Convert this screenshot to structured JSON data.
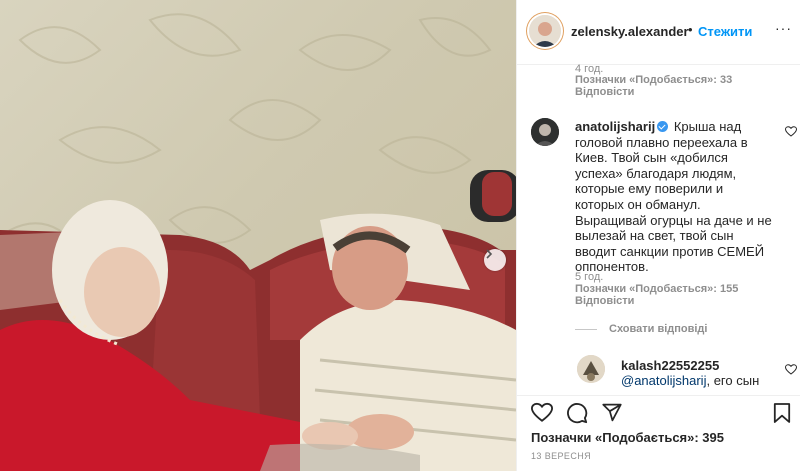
{
  "post": {
    "username": "zelensky.alexander",
    "separator": "•",
    "follow_label": "Стежити",
    "more_label": "···",
    "next_image_label": "›"
  },
  "comment1": {
    "time": "4 год.",
    "likes_label": "Позначки «Подобається»: 33",
    "replies_label": "Відповісти"
  },
  "comment2": {
    "username": "anatolijsharij",
    "text": "Крыша над головой плавно переехала в Киев. Твой сын «добился успеха» благодаря людям, которые ему поверили и которых он обманул. Выращивай огурцы на даче и не вылезай на свет, твой сын вводит санкции против СЕМЕЙ оппонентов.",
    "time": "5 год.",
    "likes_label": "Позначки «Подобається»: 155",
    "replies_label": "Відповісти",
    "hide_replies_label": "Сховати відповіді"
  },
  "reply": {
    "username": "kalash22552255",
    "mention": "@anatolijsharij",
    "text": ", его сын"
  },
  "footer": {
    "likes_total": "Позначки «Подобається»: 395",
    "date": "13 ВЕРЕСНЯ"
  },
  "icons": {
    "like": "heart-icon",
    "comment": "comment-icon",
    "share": "share-icon",
    "save": "bookmark-icon",
    "next": "chevron-right-icon"
  },
  "colors": {
    "link": "#0095f6",
    "verified": "#3897f0",
    "muted": "#8e8e8e",
    "mention": "#00376b"
  }
}
